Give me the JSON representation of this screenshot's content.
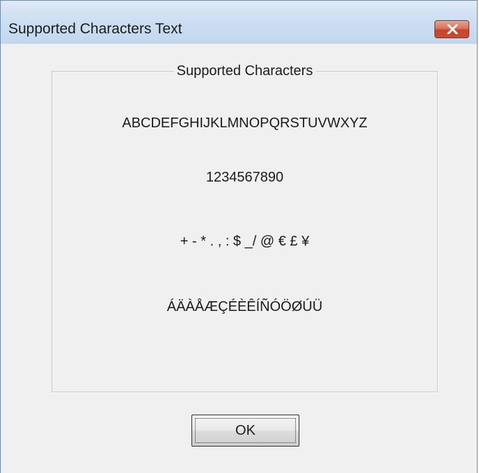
{
  "window": {
    "title": "Supported Characters Text",
    "close_icon": "close-icon"
  },
  "group": {
    "legend": "Supported Characters",
    "lines": [
      "ABCDEFGHIJKLMNOPQRSTUVWXYZ",
      "1234567890",
      "+ - * . , : $ _/ @ € £ ¥",
      "ÁÄÀÅÆÇÉÈÊÍÑÓÖØÚÜ"
    ]
  },
  "buttons": {
    "ok_label": "OK"
  },
  "colors": {
    "titlebar": "#cddff2",
    "close_button": "#c8442b",
    "dialog_background": "#f0f0f0"
  }
}
